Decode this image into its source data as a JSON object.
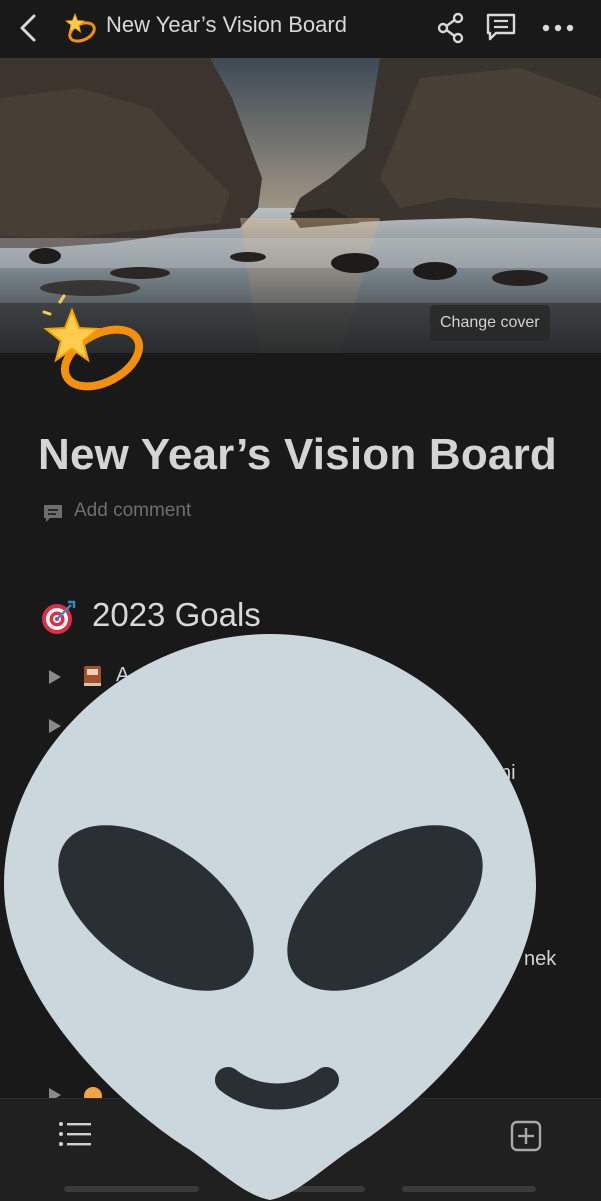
{
  "header": {
    "title": "New Year’s Vision Board"
  },
  "icons": {
    "back": "chevron-left-icon",
    "share": "share-icon",
    "comments": "comment-bubble-icon",
    "more": "more-horizontal-icon",
    "title_emoji": "dizzy-star-emoji",
    "target": "direct-hit-emoji",
    "list": "list-icon",
    "add": "add-block-icon",
    "overlay": "alien-emoji"
  },
  "cover": {
    "change_cover_label": "Change cover"
  },
  "page": {
    "title": "New Year’s Vision Board",
    "add_comment": "Add comment"
  },
  "sections": [
    {
      "heading": "2023 Goals",
      "items": [
        {
          "label": "A"
        },
        {
          "label": ""
        },
        {
          "label": ""
        }
      ],
      "partial_text": [
        "ni",
        "nek"
      ]
    }
  ],
  "colors": {
    "background": "#191919",
    "text": "#d4d4d4",
    "muted": "#6e6e6e",
    "bottom_bar": "#202020",
    "alien": "#ccd6dd",
    "alien_eyes": "#292f33"
  }
}
